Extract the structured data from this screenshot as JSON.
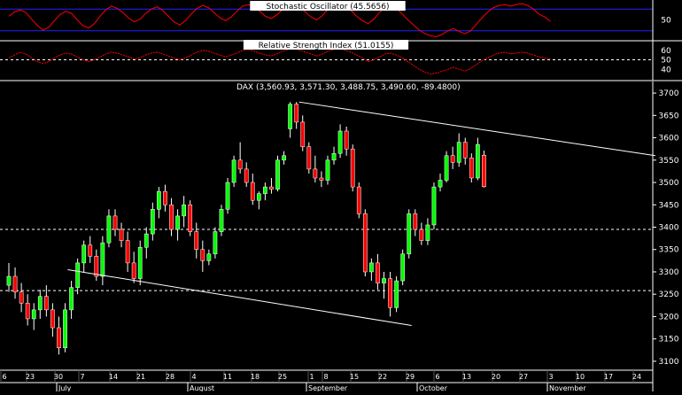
{
  "chart_data": [
    {
      "type": "line",
      "title": "Stochastic Oscillator (45.5656)",
      "y_ticks": [
        50
      ],
      "reference_lines": [
        80,
        20
      ],
      "ylim": [
        0,
        100
      ],
      "colors": {
        "line": "#ff0000",
        "reference": "#2222ff",
        "title_bg": "#ffffff",
        "title_text": "#000000"
      },
      "values": [
        60,
        72,
        78,
        70,
        52,
        35,
        22,
        30,
        48,
        65,
        74,
        68,
        50,
        34,
        28,
        40,
        60,
        78,
        88,
        82,
        70,
        55,
        45,
        52,
        68,
        80,
        86,
        76,
        60,
        44,
        36,
        48,
        66,
        82,
        90,
        84,
        70,
        56,
        48,
        58,
        74,
        88,
        92,
        86,
        74,
        60,
        54,
        64,
        78,
        90,
        94,
        88,
        72,
        58,
        50,
        62,
        80,
        92,
        96,
        90,
        76,
        60,
        48,
        40,
        52,
        70,
        84,
        90,
        82,
        66,
        50,
        36,
        22,
        12,
        6,
        4,
        10,
        20,
        26,
        18,
        12,
        20,
        38,
        56,
        72,
        84,
        90,
        92,
        88,
        92,
        95,
        90,
        80,
        66,
        58,
        46
      ]
    },
    {
      "type": "line",
      "title": "Relative Strength Index (51.0155)",
      "y_ticks": [
        60,
        50,
        40
      ],
      "reference_lines": [
        50
      ],
      "ylim": [
        30,
        70
      ],
      "colors": {
        "line": "#ff0000",
        "reference": "#ffffff",
        "title_bg": "#ffffff",
        "title_text": "#000000"
      },
      "values": [
        52,
        55,
        58,
        56,
        52,
        48,
        46,
        48,
        52,
        55,
        57,
        56,
        53,
        50,
        48,
        50,
        53,
        56,
        58,
        57,
        55,
        53,
        51,
        52,
        55,
        57,
        58,
        56,
        54,
        52,
        50,
        52,
        55,
        58,
        60,
        59,
        57,
        55,
        53,
        55,
        57,
        60,
        61,
        59,
        57,
        55,
        54,
        56,
        59,
        61,
        62,
        60,
        58,
        56,
        54,
        56,
        59,
        61,
        62,
        60,
        58,
        55,
        52,
        48,
        50,
        53,
        56,
        57,
        55,
        52,
        48,
        44,
        40,
        37,
        35,
        36,
        38,
        40,
        42,
        40,
        38,
        41,
        45,
        49,
        52,
        55,
        57,
        58,
        56,
        57,
        58,
        57,
        55,
        53,
        52,
        51
      ]
    },
    {
      "type": "candlestick",
      "title": "DAX (3,560.93, 3,571.30, 3,488.75, 3,490.60, -89.4800)",
      "y_ticks": [
        3700,
        3650,
        3600,
        3550,
        3500,
        3450,
        3400,
        3350,
        3300,
        3250,
        3200,
        3150,
        3100
      ],
      "ylim": [
        3080,
        3720
      ],
      "reference_lines": [
        3395,
        3258
      ],
      "x_labels": [
        "6",
        "23",
        "30",
        "7",
        "14",
        "21",
        "28",
        "4",
        "11",
        "18",
        "25",
        "1",
        "8",
        "15",
        "22",
        "29",
        "6",
        "13",
        "20",
        "27",
        "3",
        "10",
        "17",
        "24"
      ],
      "month_labels": [
        "July",
        "August",
        "September",
        "October",
        "November"
      ],
      "colors": {
        "up": "#00ff00",
        "down": "#ff0000",
        "wick": "#ffffff",
        "grid": "#ffffff",
        "trendline": "#ffffff",
        "axis_text": "#ffffff"
      },
      "candles": [
        [
          3270,
          3320,
          3255,
          3290
        ],
        [
          3290,
          3310,
          3240,
          3255
        ],
        [
          3255,
          3275,
          3210,
          3230
        ],
        [
          3230,
          3250,
          3180,
          3195
        ],
        [
          3195,
          3230,
          3170,
          3215
        ],
        [
          3215,
          3260,
          3195,
          3245
        ],
        [
          3245,
          3270,
          3200,
          3215
        ],
        [
          3215,
          3230,
          3155,
          3175
        ],
        [
          3175,
          3200,
          3115,
          3130
        ],
        [
          3130,
          3230,
          3120,
          3215
        ],
        [
          3215,
          3280,
          3195,
          3265
        ],
        [
          3265,
          3330,
          3250,
          3320
        ],
        [
          3320,
          3370,
          3300,
          3360
        ],
        [
          3360,
          3380,
          3320,
          3335
        ],
        [
          3335,
          3350,
          3280,
          3290
        ],
        [
          3290,
          3380,
          3270,
          3365
        ],
        [
          3365,
          3440,
          3355,
          3425
        ],
        [
          3425,
          3440,
          3380,
          3395
        ],
        [
          3395,
          3410,
          3355,
          3370
        ],
        [
          3370,
          3390,
          3300,
          3320
        ],
        [
          3320,
          3345,
          3275,
          3285
        ],
        [
          3285,
          3370,
          3270,
          3355
        ],
        [
          3355,
          3400,
          3330,
          3385
        ],
        [
          3385,
          3455,
          3370,
          3440
        ],
        [
          3440,
          3490,
          3420,
          3480
        ],
        [
          3480,
          3495,
          3435,
          3450
        ],
        [
          3450,
          3465,
          3380,
          3395
        ],
        [
          3395,
          3440,
          3370,
          3425
        ],
        [
          3425,
          3470,
          3400,
          3450
        ],
        [
          3450,
          3460,
          3380,
          3390
        ],
        [
          3390,
          3410,
          3330,
          3350
        ],
        [
          3350,
          3370,
          3300,
          3325
        ],
        [
          3325,
          3350,
          3315,
          3340
        ],
        [
          3340,
          3400,
          3330,
          3390
        ],
        [
          3390,
          3450,
          3380,
          3440
        ],
        [
          3440,
          3510,
          3430,
          3500
        ],
        [
          3500,
          3560,
          3490,
          3550
        ],
        [
          3550,
          3590,
          3520,
          3530
        ],
        [
          3530,
          3545,
          3490,
          3500
        ],
        [
          3500,
          3520,
          3450,
          3460
        ],
        [
          3460,
          3480,
          3440,
          3475
        ],
        [
          3475,
          3500,
          3460,
          3490
        ],
        [
          3490,
          3510,
          3475,
          3485
        ],
        [
          3485,
          3560,
          3480,
          3550
        ],
        [
          3550,
          3570,
          3540,
          3560
        ],
        [
          3620,
          3680,
          3600,
          3675
        ],
        [
          3675,
          3680,
          3620,
          3635
        ],
        [
          3635,
          3650,
          3570,
          3580
        ],
        [
          3580,
          3590,
          3520,
          3530
        ],
        [
          3530,
          3560,
          3500,
          3510
        ],
        [
          3510,
          3525,
          3490,
          3505
        ],
        [
          3505,
          3560,
          3495,
          3550
        ],
        [
          3550,
          3580,
          3540,
          3565
        ],
        [
          3565,
          3630,
          3555,
          3615
        ],
        [
          3615,
          3625,
          3560,
          3575
        ],
        [
          3575,
          3585,
          3480,
          3490
        ],
        [
          3490,
          3500,
          3420,
          3430
        ],
        [
          3430,
          3440,
          3290,
          3300
        ],
        [
          3300,
          3330,
          3280,
          3320
        ],
        [
          3320,
          3340,
          3260,
          3275
        ],
        [
          3275,
          3300,
          3240,
          3285
        ],
        [
          3285,
          3300,
          3200,
          3220
        ],
        [
          3220,
          3290,
          3210,
          3280
        ],
        [
          3280,
          3350,
          3270,
          3340
        ],
        [
          3340,
          3440,
          3330,
          3430
        ],
        [
          3430,
          3440,
          3380,
          3395
        ],
        [
          3395,
          3410,
          3360,
          3370
        ],
        [
          3370,
          3420,
          3360,
          3405
        ],
        [
          3405,
          3500,
          3395,
          3490
        ],
        [
          3490,
          3520,
          3480,
          3505
        ],
        [
          3505,
          3570,
          3500,
          3560
        ],
        [
          3560,
          3580,
          3530,
          3545
        ],
        [
          3545,
          3610,
          3535,
          3590
        ],
        [
          3590,
          3600,
          3540,
          3555
        ],
        [
          3555,
          3565,
          3500,
          3510
        ],
        [
          3510,
          3600,
          3505,
          3585
        ],
        [
          3560.93,
          3571.3,
          3488.75,
          3490.6
        ]
      ],
      "trendlines": [
        {
          "from": [
            45,
            3680
          ],
          "to": [
            102,
            3560
          ]
        },
        {
          "from": [
            8,
            3305
          ],
          "to": [
            63,
            3180
          ]
        }
      ]
    }
  ]
}
